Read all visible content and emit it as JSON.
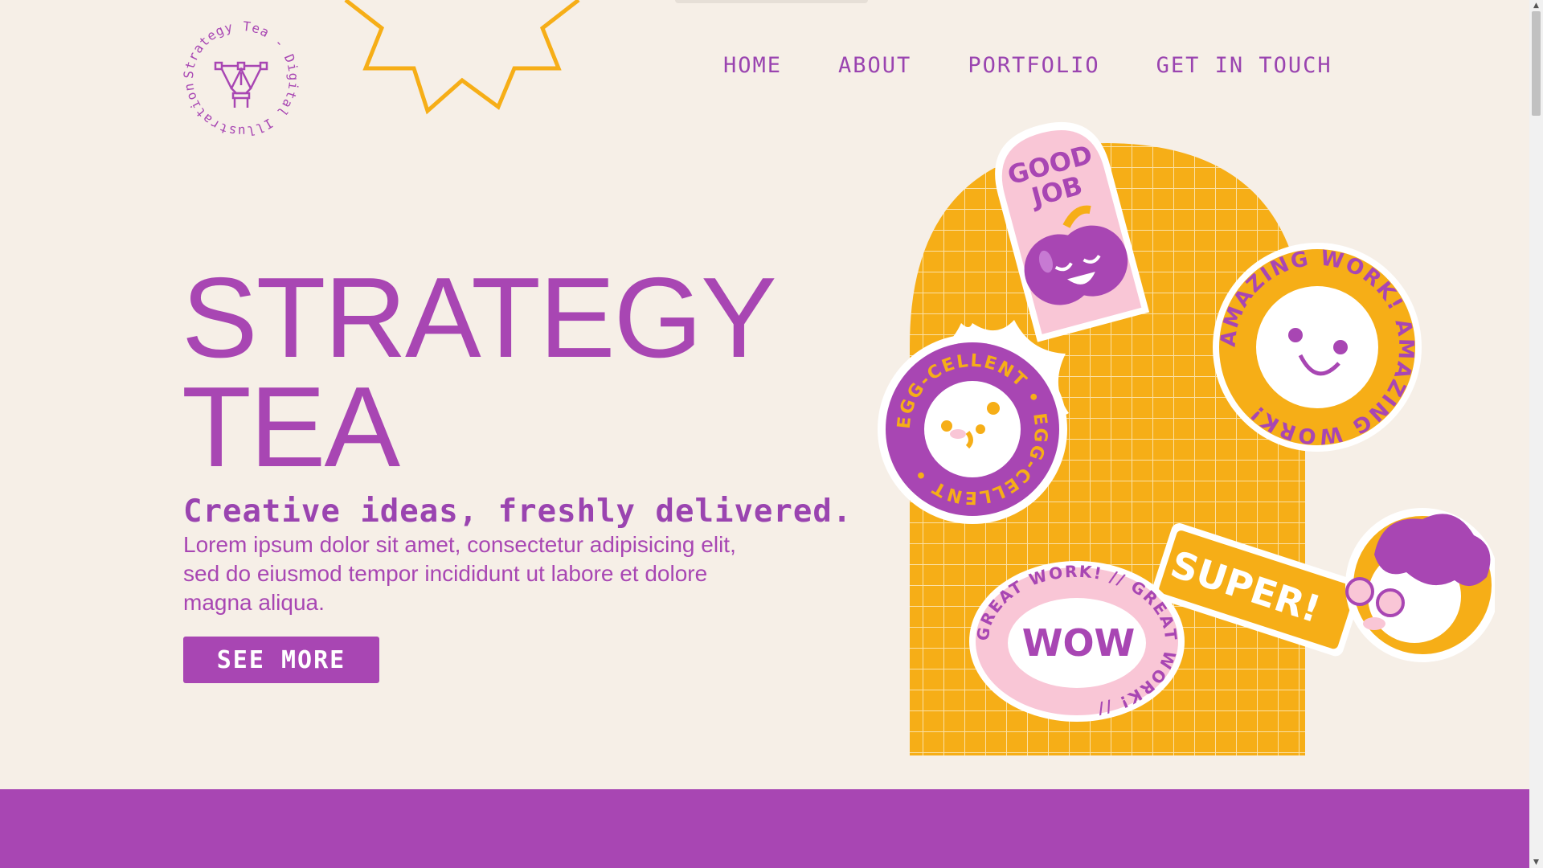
{
  "colors": {
    "background": "#f6efe7",
    "primary_purple": "#a846b3",
    "accent_yellow": "#f6ae17",
    "pink": "#f9c6d6",
    "white": "#ffffff"
  },
  "brand": {
    "logo_ring_text": "Strategy Tea - Digital Illustrations -",
    "logo_icon": "pen-tool-icon"
  },
  "nav": {
    "items": [
      {
        "label": "HOME"
      },
      {
        "label": "ABOUT"
      },
      {
        "label": "PORTFOLIO"
      },
      {
        "label": "GET IN TOUCH"
      }
    ]
  },
  "hero": {
    "title_line1": "STRATEGY",
    "title_line2": "TEA",
    "tagline": "Creative ideas, freshly delivered.",
    "body": "Lorem ipsum dolor sit amet, consectetur adipisicing elit, sed do eiusmod tempor incididunt ut labore et dolore magna aliqua.",
    "cta_label": "SEE MORE"
  },
  "stickers": {
    "good_job_line1": "GOOD",
    "good_job_line2": "JOB",
    "amazing": "AMAZING WORK! AMAZING WORK!",
    "egg": "EGG-CELLENT • EGG-CELLENT •",
    "super": "SUPER!",
    "great_ring": "GREAT WORK! // GREAT WORK! // ",
    "wow": "WOW"
  }
}
